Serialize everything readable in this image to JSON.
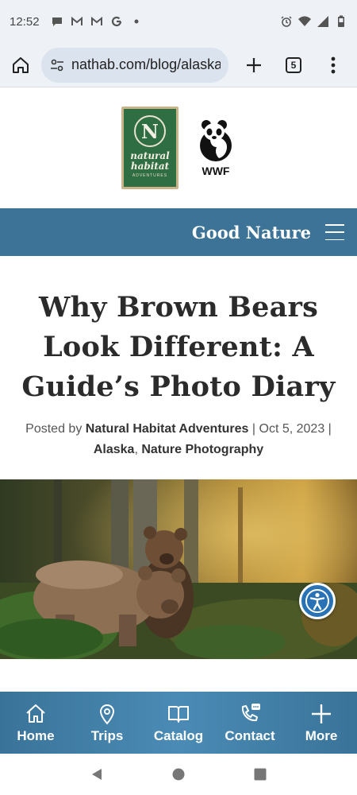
{
  "status_bar": {
    "time": "12:52",
    "left_icons": [
      "chat-bubble-icon",
      "gmail-icon",
      "gmail-icon",
      "google-icon",
      "dot-icon"
    ],
    "right_icons": [
      "alarm-icon",
      "wifi-icon",
      "signal-icon",
      "battery-icon"
    ]
  },
  "browser": {
    "url": "nathab.com/blog/alaska-",
    "tab_count": "5"
  },
  "logos": {
    "nh_initial": "N",
    "nh_line1": "natural",
    "nh_line2": "habitat",
    "nh_line3": "ADVENTURES",
    "wwf": "WWF"
  },
  "brand": {
    "title": "Good Nature"
  },
  "article": {
    "title": "Why Brown Bears Look Different: A Guide’s Photo Diary",
    "posted_by_prefix": "Posted by",
    "author": "Natural Habitat Adventures",
    "date": "Oct 5, 2023",
    "category_1": "Alaska",
    "category_2": "Nature Photography"
  },
  "bottom_nav": {
    "items": [
      {
        "label": "Home",
        "icon": "home-icon"
      },
      {
        "label": "Trips",
        "icon": "map-pin-icon"
      },
      {
        "label": "Catalog",
        "icon": "book-icon"
      },
      {
        "label": "Contact",
        "icon": "phone-chat-icon"
      },
      {
        "label": "More",
        "icon": "plus-icon"
      }
    ]
  },
  "colors": {
    "brand_blue": "#3c7397",
    "nh_green": "#2f6e43",
    "accessibility_blue": "#2872b5"
  }
}
